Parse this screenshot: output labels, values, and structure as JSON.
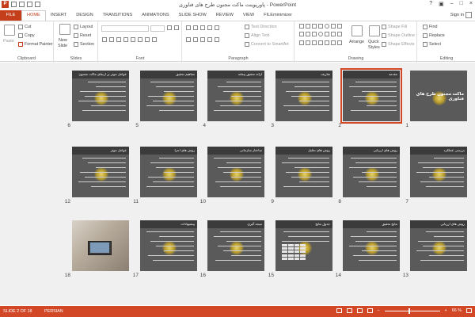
{
  "window": {
    "title": "پاورپوینت ماکت مجنون طرح های فناوری - PowerPoint",
    "app_icon": "P"
  },
  "tabs": [
    {
      "label": "FILE"
    },
    {
      "label": "HOME"
    },
    {
      "label": "INSERT"
    },
    {
      "label": "DESIGN"
    },
    {
      "label": "TRANSITIONS"
    },
    {
      "label": "ANIMATIONS"
    },
    {
      "label": "SLIDE SHOW"
    },
    {
      "label": "REVIEW"
    },
    {
      "label": "VIEW"
    },
    {
      "label": "FILEminimizer"
    }
  ],
  "account": {
    "signin": "Sign in"
  },
  "ribbon": {
    "clipboard": {
      "label": "Clipboard",
      "paste": "Paste",
      "cut": "Cut",
      "copy": "Copy",
      "format_painter": "Format Painter"
    },
    "slides": {
      "label": "Slides",
      "new_slide": "New",
      "new_slide2": "Slide",
      "layout": "Layout",
      "reset": "Reset",
      "section": "Section"
    },
    "font": {
      "label": "Font"
    },
    "paragraph": {
      "label": "Paragraph",
      "text_direction": "Text Direction",
      "align_text": "Align Text",
      "convert_smartart": "Convert to SmartArt"
    },
    "drawing": {
      "label": "Drawing",
      "arrange": "Arrange",
      "quick_styles": "Quick",
      "quick_styles2": "Styles",
      "shape_fill": "Shape Fill",
      "shape_outline": "Shape Outline",
      "shape_effects": "Shape Effects"
    },
    "editing": {
      "label": "Editing",
      "find": "Find",
      "replace": "Replace",
      "select": "Select"
    }
  },
  "slides": [
    {
      "num": "1",
      "title": "ماکت مجنون طرح های فناوری",
      "style": "cover"
    },
    {
      "num": "2",
      "title": "مقدمه",
      "style": "text",
      "selected": true
    },
    {
      "num": "3",
      "title": "تعاریف",
      "style": "text"
    },
    {
      "num": "4",
      "title": "ارائه تحقیق پیمانه",
      "style": "text"
    },
    {
      "num": "5",
      "title": "مفاهیم تحقیق",
      "style": "text"
    },
    {
      "num": "6",
      "title": "عوامل موثر بر ارتقای ماکت مجنون",
      "style": "text"
    },
    {
      "num": "7",
      "title": "بررسی عملکرد",
      "style": "text"
    },
    {
      "num": "8",
      "title": "روش های ارزیابی",
      "style": "text"
    },
    {
      "num": "9",
      "title": "روش های تحلیل",
      "style": "text"
    },
    {
      "num": "10",
      "title": "ساختار سازمانی",
      "style": "text"
    },
    {
      "num": "11",
      "title": "روش های اجرا",
      "style": "text"
    },
    {
      "num": "12",
      "title": "عوامل موثر",
      "style": "text"
    },
    {
      "num": "13",
      "title": "روش های ارزیابی",
      "style": "text"
    },
    {
      "num": "14",
      "title": "نتایج تحقیق",
      "style": "text"
    },
    {
      "num": "15",
      "title": "جدول نتایج",
      "style": "table"
    },
    {
      "num": "16",
      "title": "نتیجه گیری",
      "style": "text"
    },
    {
      "num": "17",
      "title": "پیشنهادات",
      "style": "text"
    },
    {
      "num": "18",
      "title": "",
      "style": "photo"
    }
  ],
  "status": {
    "slide_info": "SLIDE 2 OF 18",
    "language": "PERSIAN",
    "zoom": "66 %"
  },
  "colors": {
    "accent": "#d24726",
    "file_tab": "#c43e1c",
    "sorter_bg": "#f0f0f0"
  }
}
